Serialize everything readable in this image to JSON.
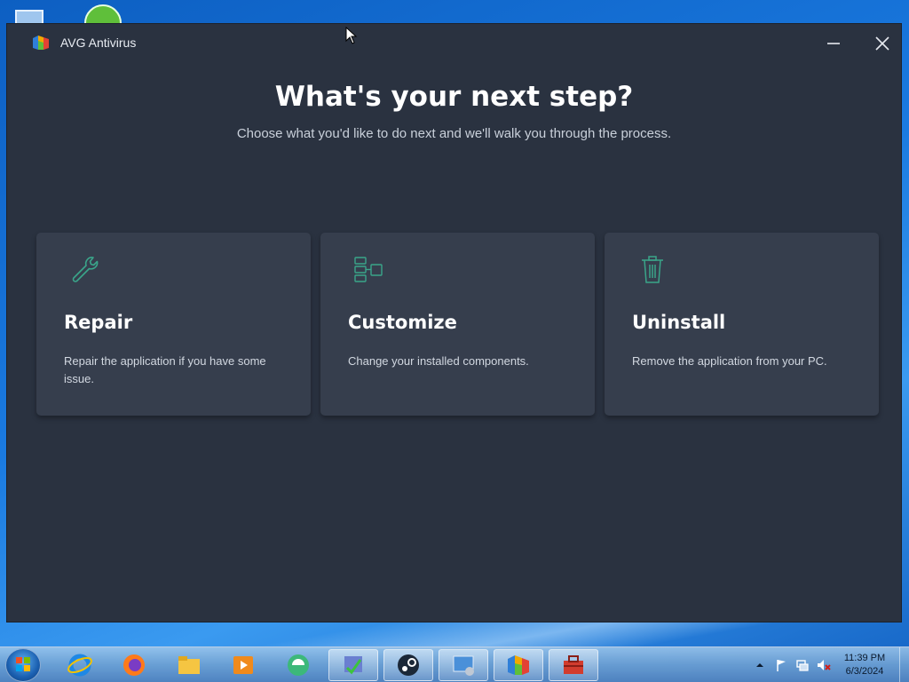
{
  "window": {
    "title": "AVG Antivirus"
  },
  "main": {
    "headline": "What's your next step?",
    "subline": "Choose what you'd like to do next and we'll walk you through the process."
  },
  "cards": [
    {
      "title": "Repair",
      "description": "Repair the application if you have some issue.",
      "icon": "wrench-icon"
    },
    {
      "title": "Customize",
      "description": "Change your installed components.",
      "icon": "components-icon"
    },
    {
      "title": "Uninstall",
      "description": "Remove the application from your PC.",
      "icon": "trash-icon"
    }
  ],
  "taskbar": {
    "time": "11:39 PM",
    "date": "6/3/2024",
    "apps": [
      "internet-explorer-icon",
      "firefox-icon",
      "file-explorer-icon",
      "media-player-icon",
      "green-app-icon",
      "installer-icon",
      "steam-icon",
      "control-panel-icon",
      "avg-icon",
      "toolbox-icon"
    ]
  },
  "colors": {
    "window_bg": "#2a3240",
    "card_bg": "#363e4d",
    "icon_accent": "#3aa58a"
  }
}
